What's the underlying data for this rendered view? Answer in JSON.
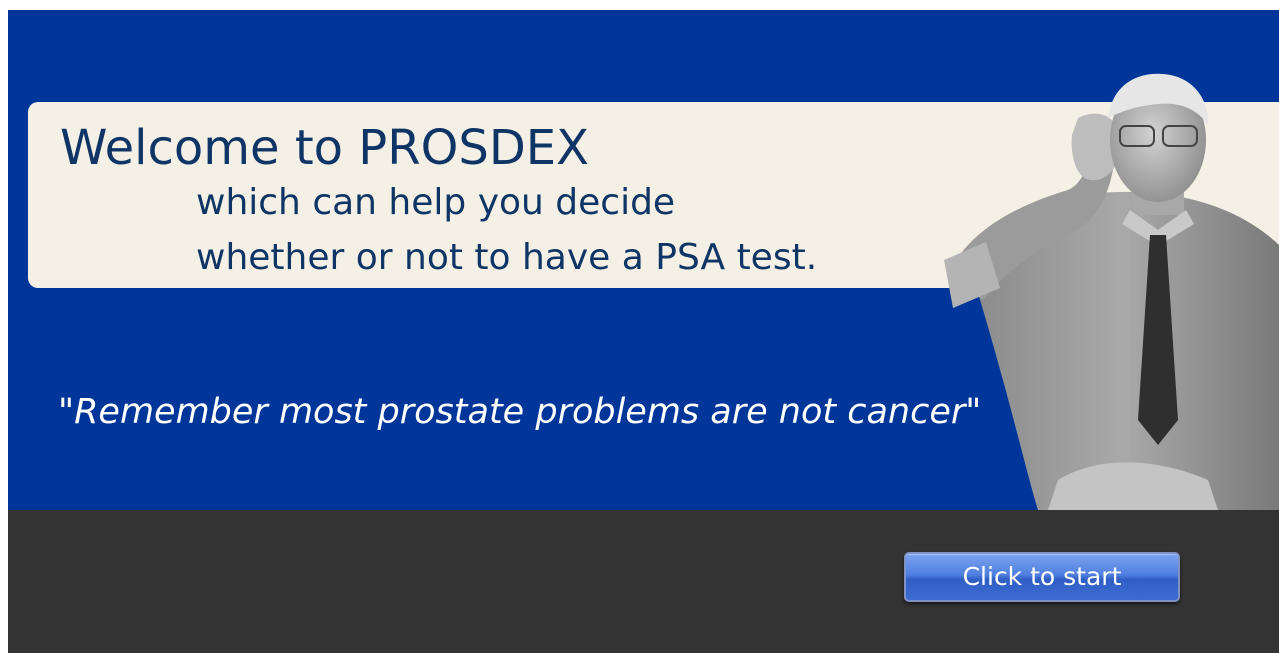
{
  "welcome": {
    "title": "Welcome to PROSDEX",
    "line1": "which can help you decide",
    "line2": "whether or not to have a PSA test."
  },
  "quote": "\"Remember most prostate problems are not cancer\"",
  "image": {
    "icon": "doctor-photo"
  },
  "actions": {
    "start_label": "Click to start"
  },
  "colors": {
    "hero_background": "#00369a",
    "panel_background": "#f4f0e6",
    "title_text": "#0f3566",
    "bottom_bar": "#333333",
    "button_blue": "#4f7fe0"
  }
}
